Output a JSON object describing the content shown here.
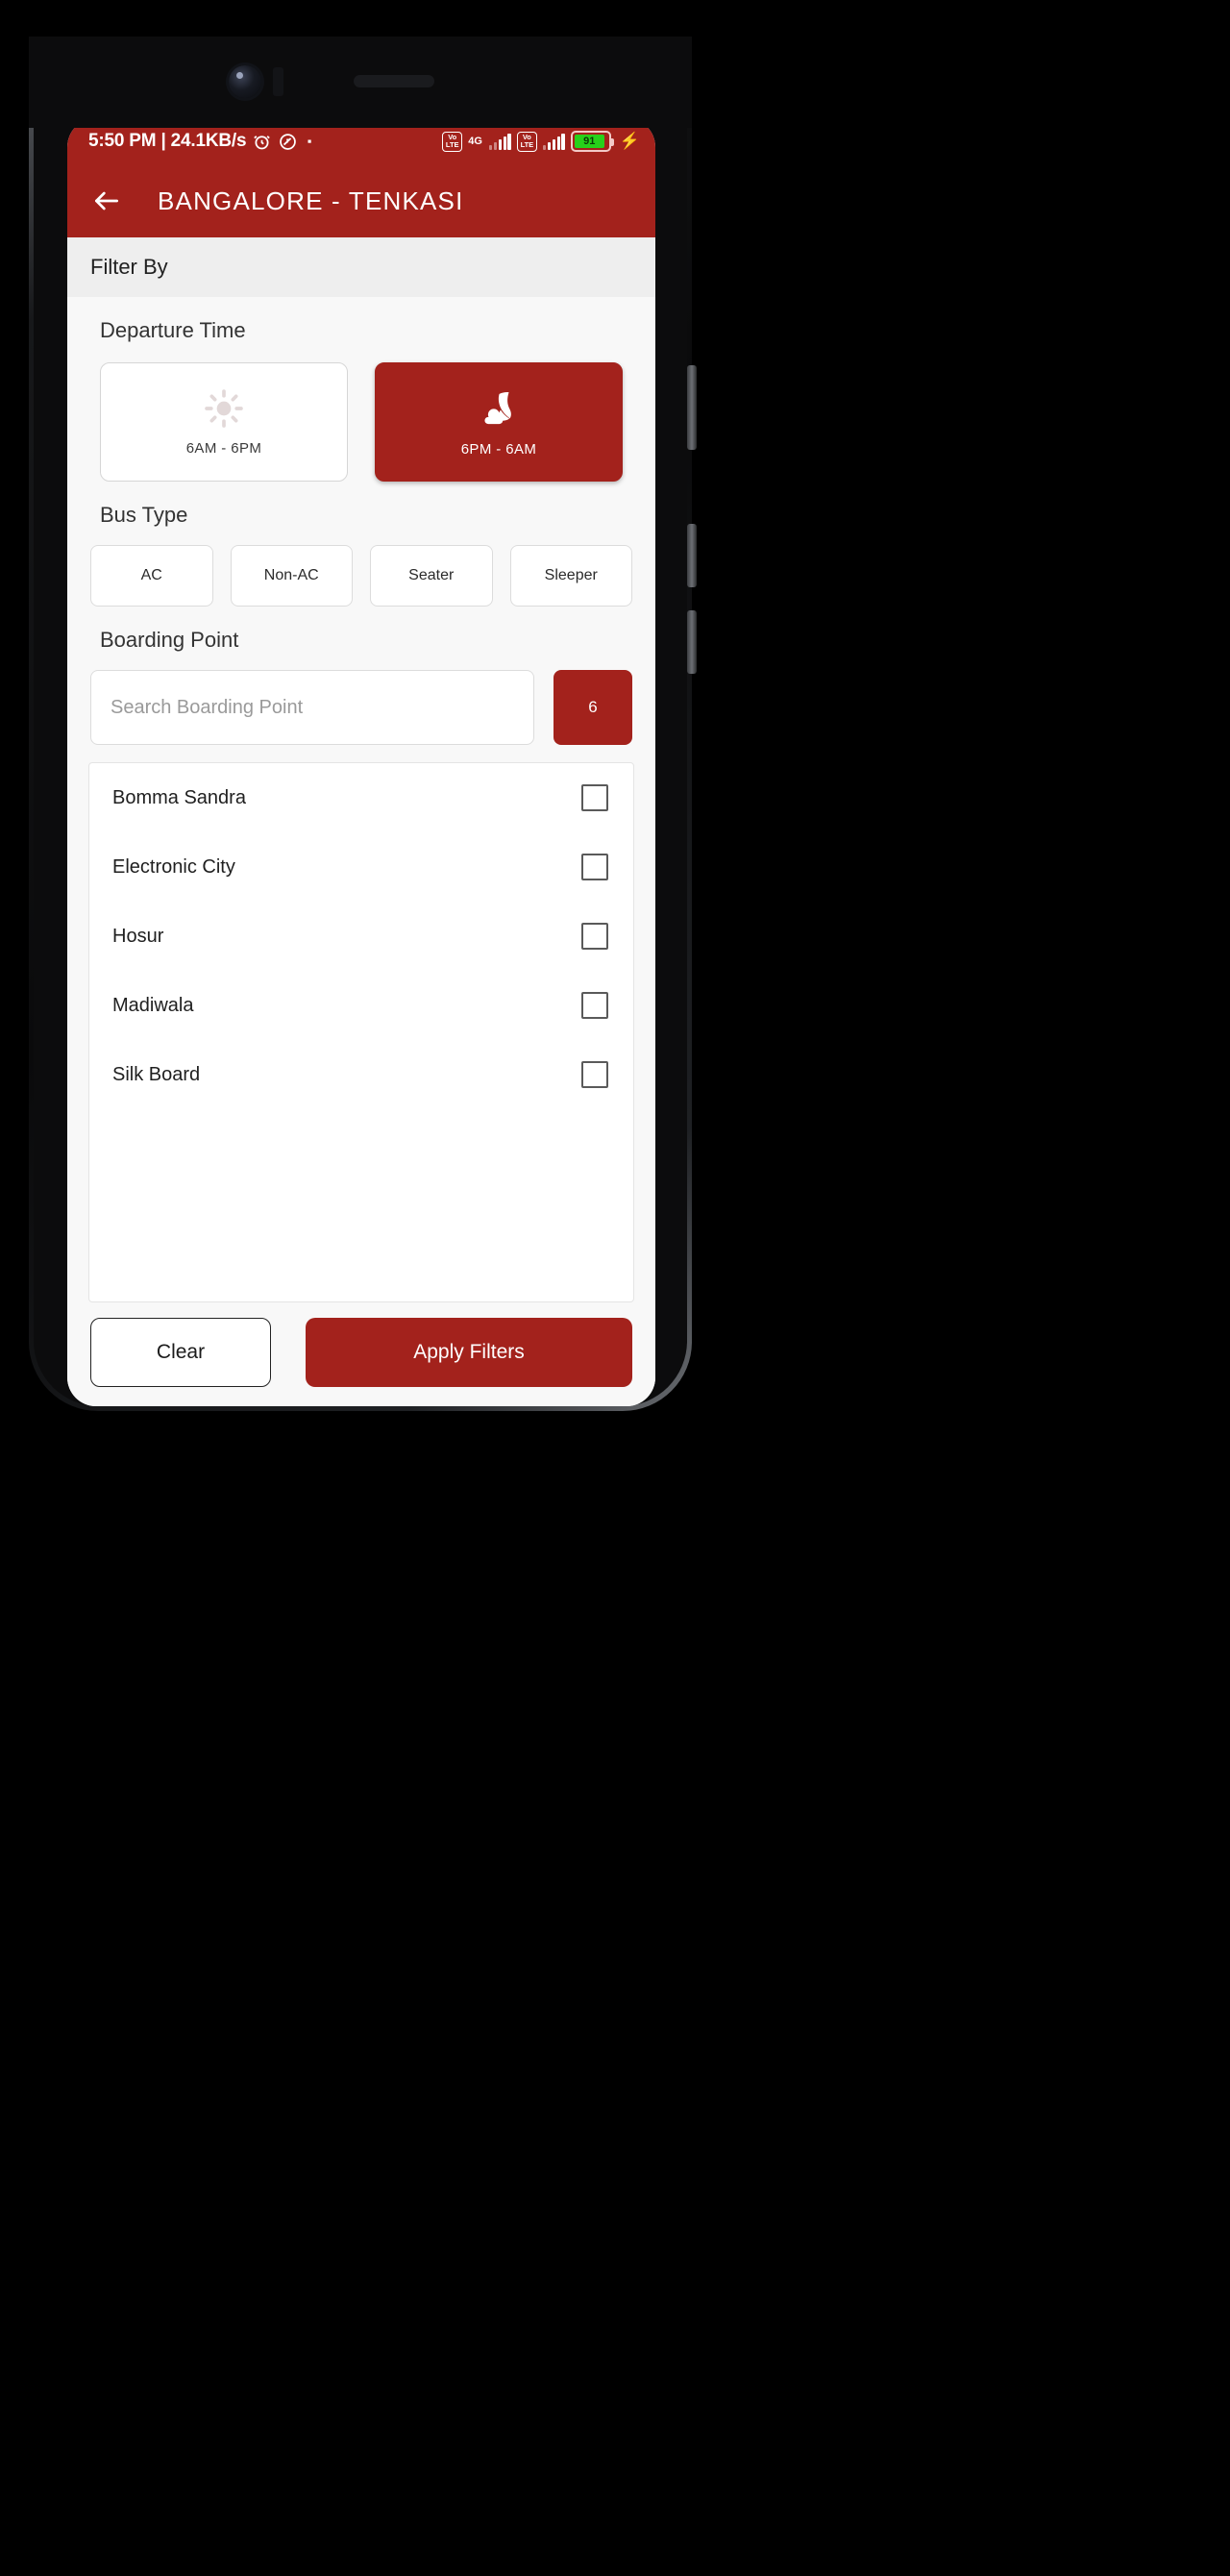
{
  "theme": {
    "brand_red": "#a3221c",
    "screen_bg": "#f8f8f8",
    "filter_bar_bg": "#eeeeee",
    "card_white": "#ffffff",
    "battery_green": "#27d11a"
  },
  "status_bar": {
    "time_and_speed": "5:50 PM | 24.1KB/s",
    "alarm_icon": "alarm-clock-icon",
    "dnd_icon": "do-not-disturb-icon",
    "dot_icon": "notification-dot-icon",
    "sim1_volte": "VoLTE",
    "sim1_volte_line1": "Vo",
    "sim1_volte_line2": "LTE",
    "network_type": "4G",
    "sim2_volte_line1": "Vo",
    "sim2_volte_line2": "LTE",
    "battery_percent": "91",
    "charging_icon": "charging-bolt-icon"
  },
  "app_bar": {
    "back_icon": "back-arrow-icon",
    "title": "BANGALORE - TENKASI"
  },
  "filter_header": {
    "label": "Filter By"
  },
  "departure_time": {
    "title": "Departure Time",
    "options": [
      {
        "label": "6AM - 6PM",
        "icon": "sun-icon",
        "selected": false
      },
      {
        "label": "6PM - 6AM",
        "icon": "moon-icon",
        "selected": true
      }
    ]
  },
  "bus_type": {
    "title": "Bus Type",
    "options": [
      {
        "label": "AC",
        "selected": false
      },
      {
        "label": "Non-AC",
        "selected": false
      },
      {
        "label": "Seater",
        "selected": false
      },
      {
        "label": "Sleeper",
        "selected": false
      }
    ]
  },
  "boarding_point": {
    "title": "Boarding Point",
    "search_placeholder": "Search Boarding Point",
    "search_value": "",
    "count_badge": "6",
    "items": [
      {
        "name": "Bomma Sandra",
        "checked": false
      },
      {
        "name": "Electronic City",
        "checked": false
      },
      {
        "name": "Hosur",
        "checked": false
      },
      {
        "name": "Madiwala",
        "checked": false
      },
      {
        "name": "Silk Board",
        "checked": false
      }
    ]
  },
  "actions": {
    "clear_label": "Clear",
    "apply_label": "Apply Filters"
  }
}
